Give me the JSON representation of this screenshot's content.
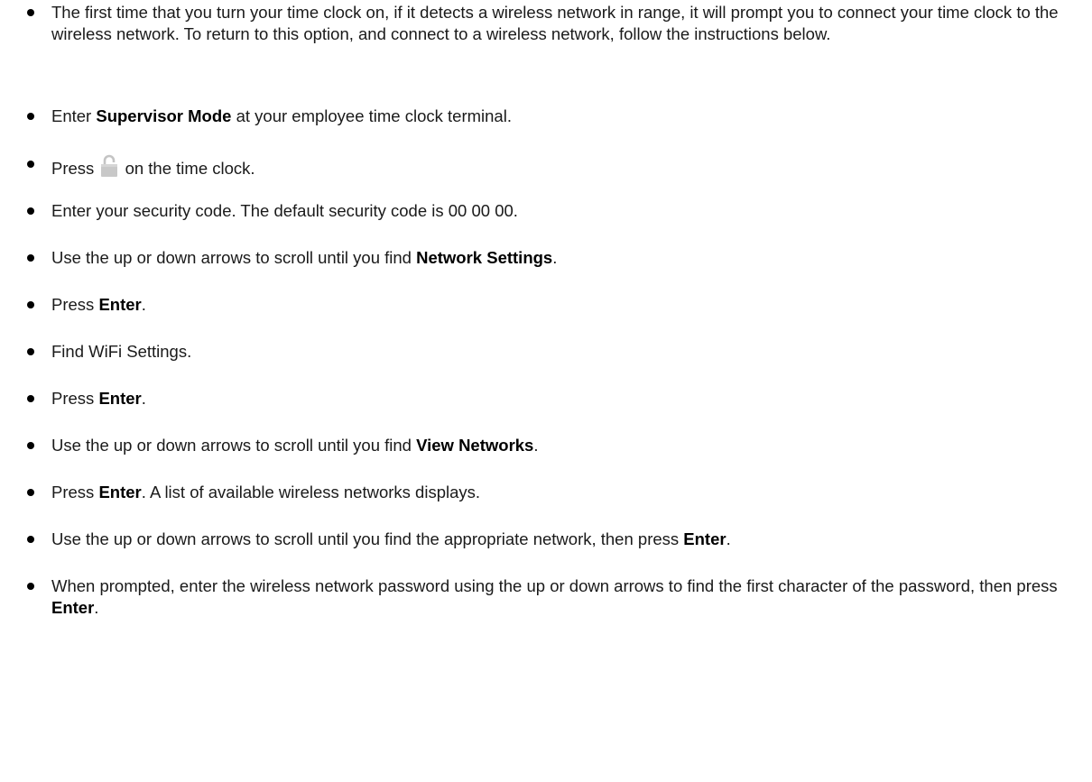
{
  "items": [
    {
      "pre": "The first time that you turn your time clock on, if it detects a wireless network in range, it will prompt you to connect your time clock to the wireless network. To return to this option, and connect to a wireless network, follow the instructions below.",
      "bold": "",
      "post": ""
    },
    {
      "pre": "Enter ",
      "bold": "Supervisor Mode",
      "post": " at your employee time clock terminal."
    },
    {
      "pre": "Press",
      "icon": "lock-icon",
      "post": " on the time clock."
    },
    {
      "pre": "Enter your security code. The default security code is 00 00 00.",
      "bold": "",
      "post": ""
    },
    {
      "pre": "Use the up or down arrows to scroll until you find ",
      "bold": "Network Settings",
      "post": "."
    },
    {
      "pre": "Press ",
      "bold": "Enter",
      "post": "."
    },
    {
      "pre": "Find WiFi Settings.",
      "bold": "",
      "post": ""
    },
    {
      "pre": "Press ",
      "bold": "Enter",
      "post": "."
    },
    {
      "pre": "Use the up or down arrows to scroll until you find ",
      "bold": "View Networks",
      "post": "."
    },
    {
      "pre": "Press ",
      "bold": "Enter",
      "post": ". A list of available wireless networks displays."
    },
    {
      "pre": "Use the up or down arrows to scroll until you find the appropriate network, then press ",
      "bold": "Enter",
      "post": "."
    },
    {
      "pre": "When prompted, enter the wireless network password using the up or down arrows to find the first character of the password, then press ",
      "bold": "Enter",
      "post": "."
    }
  ]
}
